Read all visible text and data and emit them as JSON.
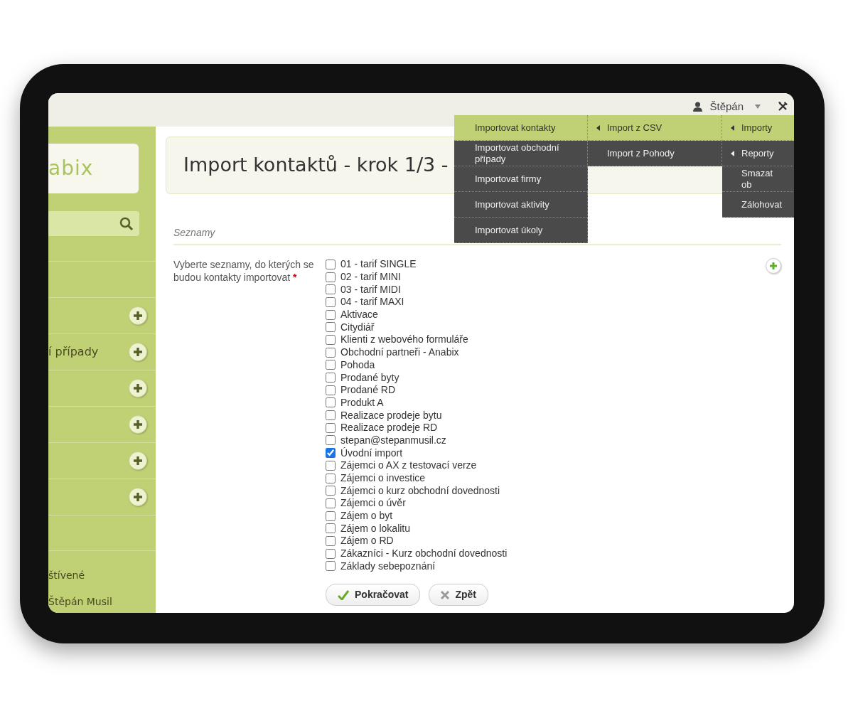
{
  "topbar": {
    "user": "Štěpán"
  },
  "sidebar": {
    "logo": "abix",
    "items": [
      {
        "kind": "blank"
      },
      {
        "kind": "add"
      },
      {
        "kind": "add",
        "label": "í případy"
      },
      {
        "kind": "add"
      },
      {
        "kind": "add"
      },
      {
        "kind": "add"
      },
      {
        "kind": "add"
      },
      {
        "kind": "blank"
      }
    ],
    "recent": {
      "heading": "štívené",
      "items": [
        "Štěpán Musil"
      ]
    }
  },
  "page": {
    "title": "Import kontaktů - krok 1/3 -",
    "section": "Seznamy",
    "field_label": "Vyberte seznamy, do kterých se budou kontakty importovat",
    "required_mark": "*",
    "lists": [
      {
        "label": "01 - tarif SINGLE",
        "checked": false
      },
      {
        "label": "02 - tarif MINI",
        "checked": false
      },
      {
        "label": "03 - tarif MIDI",
        "checked": false
      },
      {
        "label": "04 - tarif MAXI",
        "checked": false
      },
      {
        "label": "Aktivace",
        "checked": false
      },
      {
        "label": "Citydiář",
        "checked": false
      },
      {
        "label": "Klienti z webového formuláře",
        "checked": false
      },
      {
        "label": "Obchodní partneři - Anabix",
        "checked": false
      },
      {
        "label": "Pohoda",
        "checked": false
      },
      {
        "label": "Prodané byty",
        "checked": false
      },
      {
        "label": "Prodané RD",
        "checked": false
      },
      {
        "label": "Produkt A",
        "checked": false
      },
      {
        "label": "Realizace prodeje bytu",
        "checked": false
      },
      {
        "label": "Realizace prodeje RD",
        "checked": false
      },
      {
        "label": "stepan@stepanmusil.cz",
        "checked": false
      },
      {
        "label": "Úvodní import",
        "checked": true
      },
      {
        "label": "Zájemci o AX z testovací verze",
        "checked": false
      },
      {
        "label": "Zájemci o investice",
        "checked": false
      },
      {
        "label": "Zájemci o kurz obchodní dovednosti",
        "checked": false
      },
      {
        "label": "Zájemci o úvěr",
        "checked": false
      },
      {
        "label": "Zájem o byt",
        "checked": false
      },
      {
        "label": "Zájem o lokalitu",
        "checked": false
      },
      {
        "label": "Zájem o RD",
        "checked": false
      },
      {
        "label": "Zákazníci - Kurz obchodní dovednosti",
        "checked": false
      },
      {
        "label": "Základy sebepoznání",
        "checked": false
      }
    ],
    "buttons": [
      {
        "label": "Pokračovat",
        "kind": "ok"
      },
      {
        "label": "Zpět",
        "kind": "back"
      }
    ]
  },
  "menu": {
    "columns": [
      [
        {
          "label": "Importovat kontakty",
          "selected": true,
          "submenu": false
        },
        {
          "label": "Importovat obchodní případy",
          "selected": false,
          "submenu": false
        },
        {
          "label": "Importovat firmy",
          "selected": false,
          "submenu": false
        },
        {
          "label": "Importovat aktivity",
          "selected": false,
          "submenu": false
        },
        {
          "label": "Importovat úkoly",
          "selected": false,
          "submenu": false
        }
      ],
      [
        {
          "label": "Import z CSV",
          "selected": true,
          "submenu": true
        },
        {
          "label": "Import z Pohody",
          "selected": false,
          "submenu": false
        }
      ],
      [
        {
          "label": "Importy",
          "selected": true,
          "submenu": true
        },
        {
          "label": "Reporty",
          "selected": false,
          "submenu": true
        },
        {
          "label": "Smazat ob",
          "selected": false,
          "submenu": false
        },
        {
          "label": "Zálohovat",
          "selected": false,
          "submenu": false
        }
      ]
    ]
  }
}
